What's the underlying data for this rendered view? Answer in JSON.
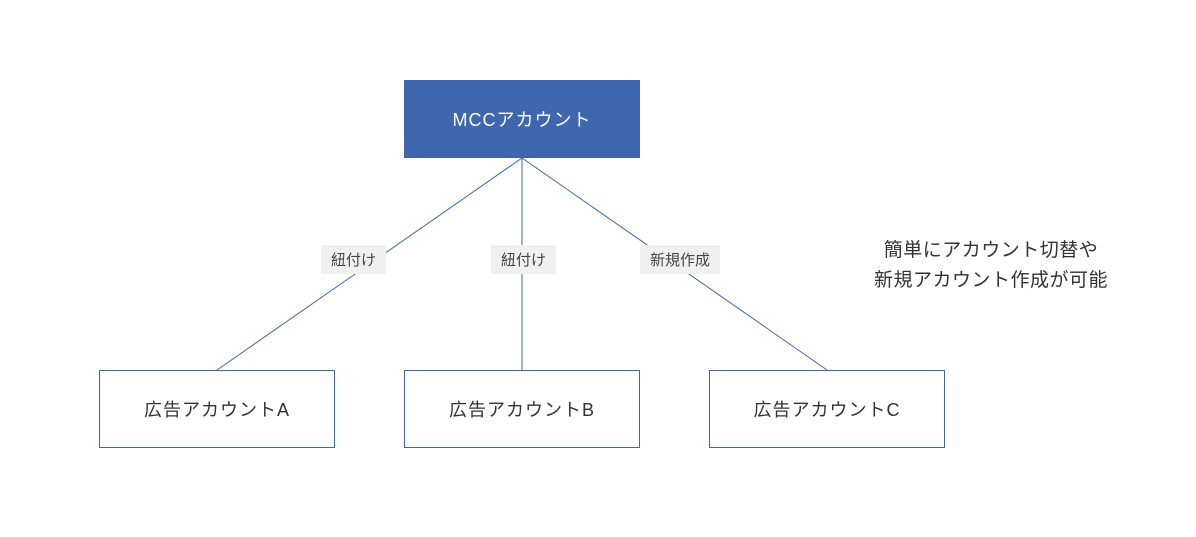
{
  "root": {
    "label": "MCCアカウント"
  },
  "children": [
    {
      "label": "広告アカウントA",
      "edge_label": "紐付け"
    },
    {
      "label": "広告アカウントB",
      "edge_label": "紐付け"
    },
    {
      "label": "広告アカウントC",
      "edge_label": "新規作成"
    }
  ],
  "caption": {
    "line1": "簡単にアカウント切替や",
    "line2": "新規アカウント作成が可能"
  },
  "colors": {
    "root_bg": "#3e67b0",
    "border": "#3e67b0",
    "label_bg": "#f0f0f0"
  }
}
